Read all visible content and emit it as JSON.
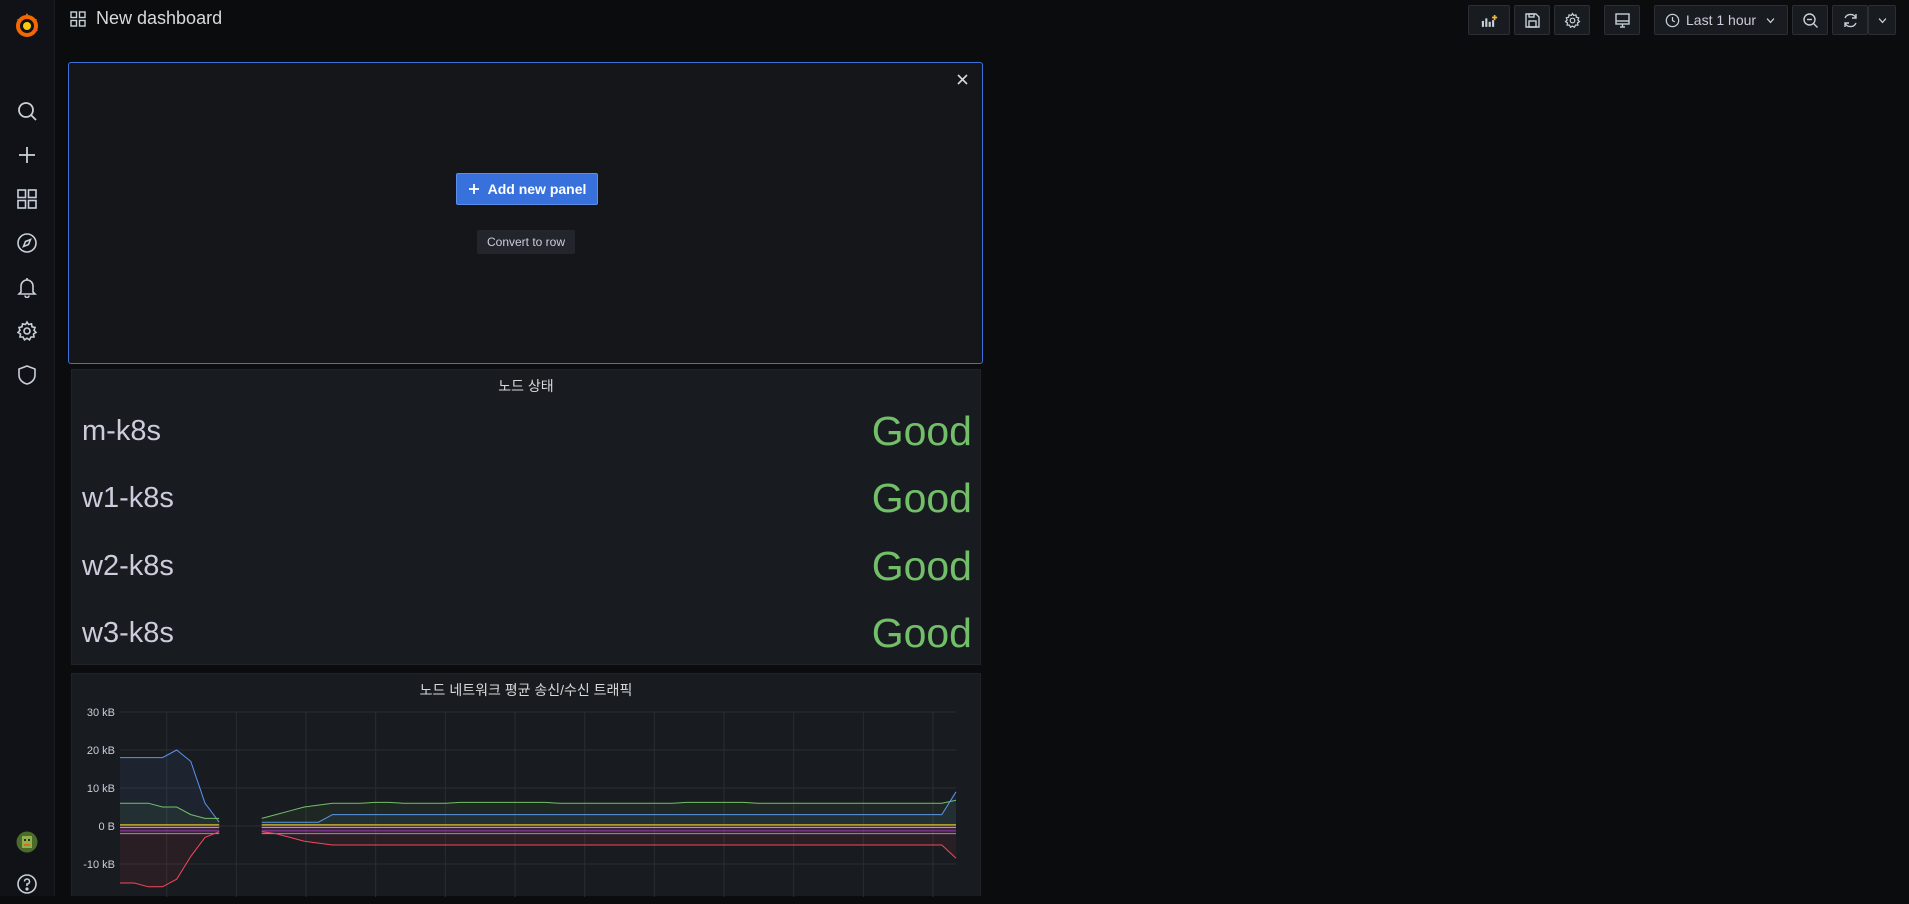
{
  "app": {
    "brand_color": "#f46800"
  },
  "header": {
    "title": "New dashboard",
    "time_range": "Last 1 hour"
  },
  "sidebar": {
    "items": [
      {
        "name": "search-icon"
      },
      {
        "name": "plus-icon"
      },
      {
        "name": "dashboards-icon"
      },
      {
        "name": "compass-icon"
      },
      {
        "name": "bell-icon"
      },
      {
        "name": "gear-icon"
      },
      {
        "name": "shield-icon"
      }
    ]
  },
  "new_panel": {
    "add_label": "Add new panel",
    "convert_label": "Convert to row"
  },
  "status_panel": {
    "title": "노드 상태",
    "rows": [
      {
        "name": "m-k8s",
        "state": "Good"
      },
      {
        "name": "w1-k8s",
        "state": "Good"
      },
      {
        "name": "w2-k8s",
        "state": "Good"
      },
      {
        "name": "w3-k8s",
        "state": "Good"
      }
    ],
    "good_color": "#73bf69"
  },
  "chart_panel": {
    "title": "노드 네트워크 평균 송신/수신 트래픽"
  },
  "chart_data": {
    "type": "line",
    "title": "노드 네트워크 평균 송신/수신 트래픽",
    "ylim": [
      -15,
      30
    ],
    "yticks": [
      "30 kB",
      "20 kB",
      "10 kB",
      "0 B",
      "-10 kB"
    ],
    "ytick_values": [
      30,
      20,
      10,
      0,
      -10
    ],
    "grid": true,
    "x_count": 60,
    "gap": [
      5,
      6
    ],
    "series": [
      {
        "color": "#5794f2",
        "values": [
          18,
          18,
          18,
          18,
          20,
          17,
          6,
          1,
          1,
          1,
          1,
          1,
          1,
          1,
          1,
          3,
          3,
          3,
          3,
          3,
          3,
          3,
          3,
          3,
          3,
          3,
          3,
          3,
          3,
          3,
          3,
          3,
          3,
          3,
          3,
          3,
          3,
          3,
          3,
          3,
          3,
          3,
          3,
          3,
          3,
          3,
          3,
          3,
          3,
          3,
          3,
          3,
          3,
          3,
          3,
          3,
          3,
          3,
          3,
          9
        ]
      },
      {
        "color": "#73bf69",
        "values": [
          6,
          6,
          6,
          5,
          5,
          3,
          2,
          2,
          2,
          2,
          2,
          3,
          4,
          5,
          5.5,
          6,
          6,
          6,
          6.2,
          6.2,
          6,
          6,
          6,
          6,
          6.2,
          6.2,
          6.2,
          6.2,
          6.2,
          6.2,
          6.2,
          6,
          6,
          6,
          6,
          6,
          6,
          6,
          6,
          6,
          6.2,
          6.2,
          6.2,
          6.2,
          6.2,
          6,
          6,
          6,
          6,
          6,
          6,
          6,
          6,
          6,
          6,
          6,
          6,
          6,
          6,
          6.8
        ]
      },
      {
        "color": "#fade2a",
        "values": [
          0.3,
          0.3,
          0.3,
          0.3,
          0.3,
          0.3,
          0.3,
          0.3,
          0.3,
          0.3,
          0.3,
          0.3,
          0.3,
          0.3,
          0.3,
          0.3,
          0.3,
          0.3,
          0.3,
          0.3,
          0.3,
          0.3,
          0.3,
          0.3,
          0.3,
          0.3,
          0.3,
          0.3,
          0.3,
          0.3,
          0.3,
          0.3,
          0.3,
          0.3,
          0.3,
          0.3,
          0.3,
          0.3,
          0.3,
          0.3,
          0.3,
          0.3,
          0.3,
          0.3,
          0.3,
          0.3,
          0.3,
          0.3,
          0.3,
          0.3,
          0.3,
          0.3,
          0.3,
          0.3,
          0.3,
          0.3,
          0.3,
          0.3,
          0.3,
          0.3
        ]
      },
      {
        "color": "#ff9830",
        "values": [
          -0.4,
          -0.4,
          -0.4,
          -0.4,
          -0.4,
          -0.4,
          -0.4,
          -0.4,
          -0.4,
          -0.4,
          -0.4,
          -0.4,
          -0.4,
          -0.4,
          -0.4,
          -0.4,
          -0.4,
          -0.4,
          -0.4,
          -0.4,
          -0.4,
          -0.4,
          -0.4,
          -0.4,
          -0.4,
          -0.4,
          -0.4,
          -0.4,
          -0.4,
          -0.4,
          -0.4,
          -0.4,
          -0.4,
          -0.4,
          -0.4,
          -0.4,
          -0.4,
          -0.4,
          -0.4,
          -0.4,
          -0.4,
          -0.4,
          -0.4,
          -0.4,
          -0.4,
          -0.4,
          -0.4,
          -0.4,
          -0.4,
          -0.4,
          -0.4,
          -0.4,
          -0.4,
          -0.4,
          -0.4,
          -0.4,
          -0.4,
          -0.4,
          -0.4,
          -0.4
        ]
      },
      {
        "color": "#b877d9",
        "values": [
          -2,
          -2,
          -2,
          -2,
          -2,
          -2,
          -2,
          -2,
          -2,
          -2,
          -2,
          -2,
          -2,
          -2,
          -2,
          -2,
          -2,
          -2,
          -2,
          -2,
          -2,
          -2,
          -2,
          -2,
          -2,
          -2,
          -2,
          -2,
          -2,
          -2,
          -2,
          -2,
          -2,
          -2,
          -2,
          -2,
          -2,
          -2,
          -2,
          -2,
          -2,
          -2,
          -2,
          -2,
          -2,
          -2,
          -2,
          -2,
          -2,
          -2,
          -2,
          -2,
          -2,
          -2,
          -2,
          -2,
          -2,
          -2,
          -2,
          -2
        ]
      },
      {
        "color": "#8f3bb8",
        "values": [
          -1.3,
          -1.3,
          -1.3,
          -1.3,
          -1.3,
          -1.3,
          -1.3,
          -1.3,
          -1.3,
          -1.3,
          -1.3,
          -1.3,
          -1.3,
          -1.3,
          -1.3,
          -1.3,
          -1.3,
          -1.3,
          -1.3,
          -1.3,
          -1.3,
          -1.3,
          -1.3,
          -1.3,
          -1.3,
          -1.3,
          -1.3,
          -1.3,
          -1.3,
          -1.3,
          -1.3,
          -1.3,
          -1.3,
          -1.3,
          -1.3,
          -1.3,
          -1.3,
          -1.3,
          -1.3,
          -1.3,
          -1.3,
          -1.3,
          -1.3,
          -1.3,
          -1.3,
          -1.3,
          -1.3,
          -1.3,
          -1.3,
          -1.3,
          -1.3,
          -1.3,
          -1.3,
          -1.3,
          -1.3,
          -1.3,
          -1.3,
          -1.3,
          -1.3,
          -1.3
        ]
      },
      {
        "color": "#f2495c",
        "values": [
          -15,
          -15,
          -16,
          -16,
          -14,
          -8,
          -3,
          -1.5,
          -1.5,
          -1.5,
          -1.5,
          -2,
          -3,
          -4,
          -4.5,
          -5,
          -5,
          -5,
          -5,
          -5,
          -5,
          -5,
          -5,
          -5,
          -5,
          -5,
          -5,
          -5,
          -5,
          -5,
          -5,
          -5,
          -5,
          -5,
          -5,
          -5,
          -5,
          -5,
          -5,
          -5,
          -5,
          -5,
          -5,
          -5,
          -5,
          -5,
          -5,
          -5,
          -5,
          -5,
          -5,
          -5,
          -5,
          -5,
          -5,
          -5,
          -5,
          -5,
          -5,
          -8.5
        ]
      }
    ]
  }
}
